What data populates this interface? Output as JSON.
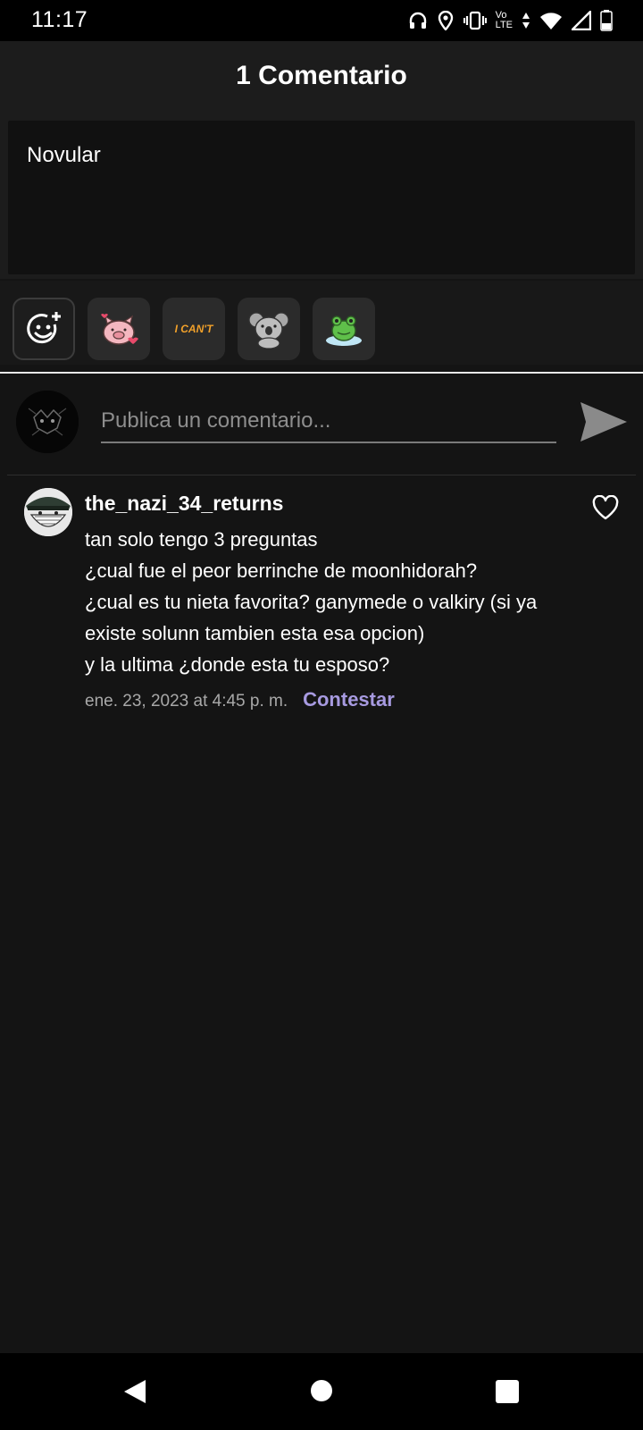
{
  "status_bar": {
    "time": "11:17",
    "volte_top": "Vo",
    "volte_bottom": "LTE",
    "icons": [
      "headphones-icon",
      "location-icon",
      "vibrate-icon",
      "volte-icon",
      "data-arrows-icon",
      "wifi-icon",
      "signal-icon",
      "battery-icon"
    ]
  },
  "header": {
    "title": "1 Comentario"
  },
  "post": {
    "text": "Novular"
  },
  "stickers": [
    {
      "name": "emoji-picker-icon"
    },
    {
      "name": "pig-sticker"
    },
    {
      "name": "i-cant-sticker",
      "text": "I CAN'T"
    },
    {
      "name": "koala-sticker"
    },
    {
      "name": "frog-sticker"
    }
  ],
  "comment_input": {
    "placeholder": "Publica un comentario...",
    "value": ""
  },
  "comment": {
    "username": "the_nazi_34_returns",
    "lines": [
      "tan solo tengo 3 preguntas",
      "¿cual fue el peor berrinche de moonhidorah?",
      "¿cual es tu nieta favorita? ganymede o valkiry (si ya",
      "existe solunn tambien esta esa opcion)",
      "y la ultima ¿donde esta tu esposo?"
    ],
    "timestamp": "ene. 23, 2023 at 4:45 p. m.",
    "reply_label": "Contestar"
  },
  "colors": {
    "background": "#141414",
    "accent": "#a79ae0",
    "send": "#8a8a8a"
  }
}
